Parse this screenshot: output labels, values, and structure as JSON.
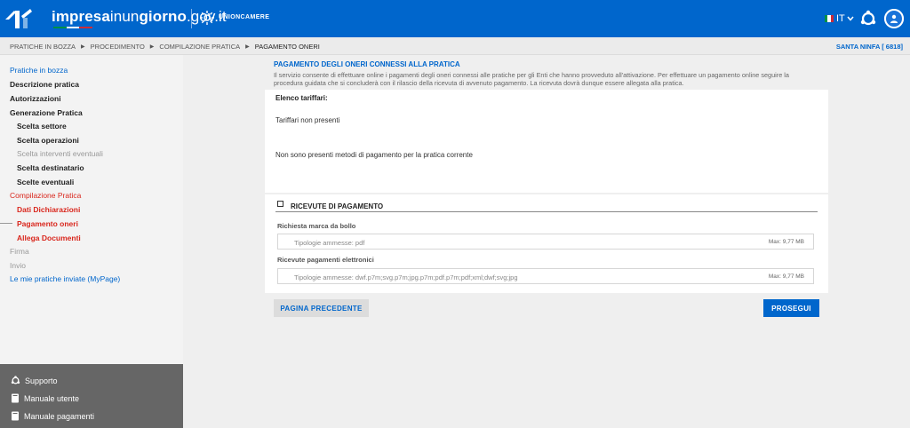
{
  "header": {
    "brand_bold": "impresa",
    "brand_mid": "inun",
    "brand_bold2": "giorno",
    "brand_suffix": ".gov.it",
    "partner_label": "UNIONCAMERE",
    "language": "IT",
    "colors": {
      "primary": "#0066cc",
      "flag_green": "#009246",
      "flag_white": "#ffffff",
      "flag_red": "#ce2b37"
    },
    "icons": [
      "logo-mark",
      "unioncamere-icon",
      "italy-flag-icon",
      "chevron-down-icon",
      "help-icon",
      "user-icon"
    ]
  },
  "breadcrumb": {
    "items": [
      "PRATICHE IN BOZZA",
      "PROCEDIMENTO",
      "COMPILAZIONE PRATICA",
      "PAGAMENTO ONERI"
    ],
    "user_code": "SANTA NINFA [ 6818]"
  },
  "sidebar": {
    "items": [
      {
        "label": "Pratiche in bozza"
      },
      {
        "label": "Descrizione pratica"
      },
      {
        "label": "Autorizzazioni"
      },
      {
        "label": "Generazione Pratica"
      },
      {
        "label": "Scelta settore"
      },
      {
        "label": "Scelta operazioni"
      },
      {
        "label": "Scelta interventi eventuali"
      },
      {
        "label": "Scelta destinatario"
      },
      {
        "label": "Scelte eventuali"
      },
      {
        "label": "Compilazione Pratica"
      },
      {
        "label": "Dati Dichiarazioni"
      },
      {
        "label": "Pagamento oneri"
      },
      {
        "label": "Allega Documenti"
      },
      {
        "label": "Firma"
      },
      {
        "label": "Invio"
      },
      {
        "label": "Le mie pratiche inviate (MyPage)"
      }
    ],
    "footer": [
      {
        "label": "Supporto",
        "icon": "support-icon"
      },
      {
        "label": "Manuale utente",
        "icon": "book-icon"
      },
      {
        "label": "Manuale pagamenti",
        "icon": "book-icon"
      }
    ]
  },
  "main": {
    "title": "PAGAMENTO DEGLI ONERI CONNESSI ALLA PRATICA",
    "description": "Il servizio consente di effettuare online i pagamenti degli oneri connessi alle pratiche per gli Enti che hanno provveduto all'attivazione. Per effettuare un pagamento online seguire la procedura guidata che si concluderà con il rilascio della ricevuta di avvenuto pagamento. La ricevuta dovrà dunque essere allegata alla pratica.",
    "elenco_label": "Elenco tariffari:",
    "tariffari_none": "Tariffari non presenti",
    "metodi_none": "Non sono presenti metodi di pagamento per la pratica corrente",
    "ricevute": {
      "title": "RICEVUTE DI PAGAMENTO",
      "marca_label": "Richiesta marca da bollo",
      "marca_placeholder": "Tipologie ammesse: pdf",
      "marca_max": "Max: 9,77 MB",
      "elettronici_label": "Ricevute pagamenti elettronici",
      "elettronici_placeholder": "Tipologie ammesse: dwf.p7m;svg.p7m;jpg.p7m;pdf.p7m;pdf;xml;dwf;svg;jpg",
      "elettronici_max": "Max: 9,77 MB"
    },
    "prev_button": "PAGINA PRECEDENTE",
    "next_button": "PROSEGUI"
  }
}
